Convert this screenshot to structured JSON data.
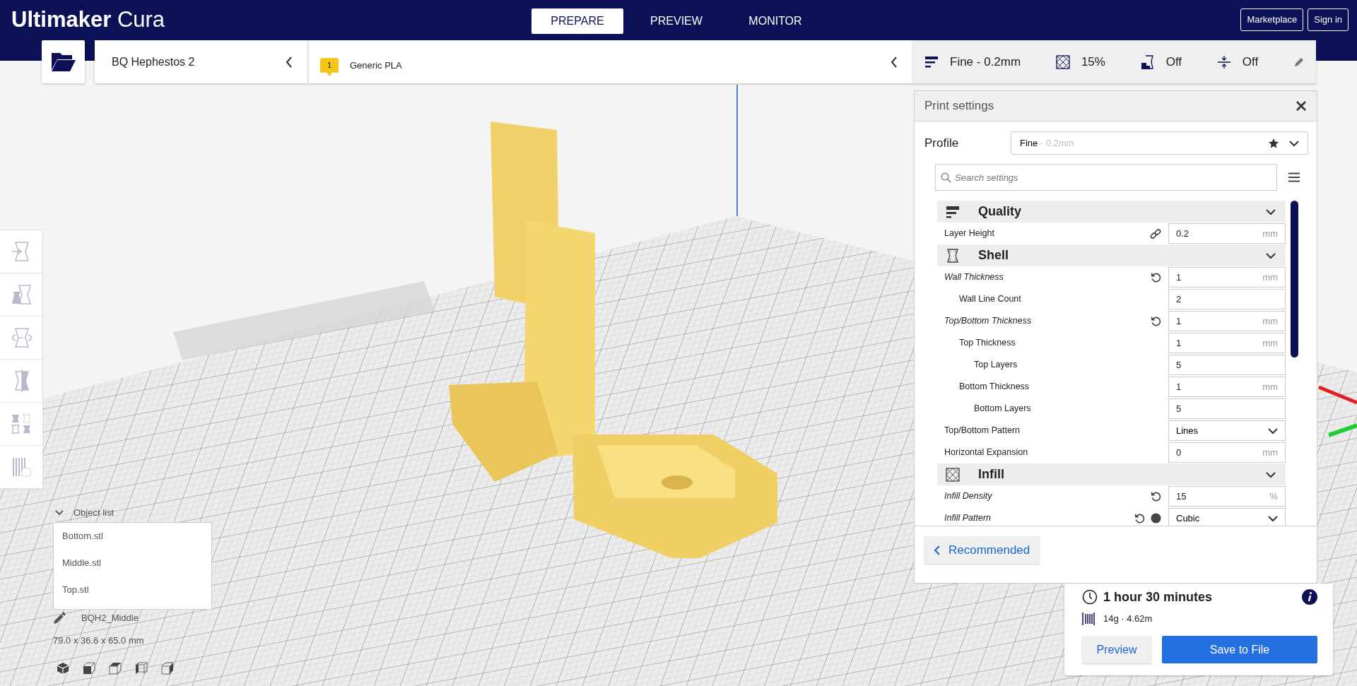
{
  "app": {
    "logo_bold": "Ultimaker",
    "logo_light": "Cura"
  },
  "stage_tabs": [
    {
      "label": "PREPARE",
      "selected": true
    },
    {
      "label": "PREVIEW",
      "selected": false
    },
    {
      "label": "MONITOR",
      "selected": false
    }
  ],
  "header_buttons": [
    "Marketplace",
    "Sign in"
  ],
  "printer": {
    "name": "BQ Hephestos 2"
  },
  "material": {
    "badge": "1",
    "name": "Generic PLA"
  },
  "print_summary": {
    "profile": "Fine - 0.2mm",
    "infill": "15%",
    "support": "Off",
    "adhesion": "Off"
  },
  "print_settings": {
    "title": "Print settings",
    "profile_label": "Profile",
    "profile_name": "Fine",
    "profile_detail": "- 0.2mm",
    "search_placeholder": "Search settings",
    "rows": [
      {
        "kind": "category",
        "label": "Quality",
        "expanded": true
      },
      {
        "kind": "text",
        "label": "Layer Height",
        "value": "0.2",
        "unit": "mm",
        "modified": false,
        "linked": true
      },
      {
        "kind": "category",
        "label": "Shell",
        "expanded": true
      },
      {
        "kind": "text",
        "label": "Wall Thickness",
        "value": "1",
        "unit": "mm",
        "modified": true,
        "children": [
          {
            "kind": "text",
            "label": "Wall Line Count",
            "value": "2",
            "modified": false
          }
        ]
      },
      {
        "kind": "text",
        "label": "Top/Bottom Thickness",
        "value": "1",
        "unit": "mm",
        "modified": true,
        "children": [
          {
            "kind": "text",
            "label": "Top Thickness",
            "value": "1",
            "unit": "mm",
            "modified": false,
            "children": [
              {
                "kind": "text",
                "label": "Top Layers",
                "value": "5",
                "modified": false
              }
            ]
          },
          {
            "kind": "text",
            "label": "Bottom Thickness",
            "value": "1",
            "unit": "mm",
            "modified": false,
            "children": [
              {
                "kind": "text",
                "label": "Bottom Layers",
                "value": "5",
                "modified": false
              }
            ]
          }
        ]
      },
      {
        "kind": "dropdown",
        "label": "Top/Bottom Pattern",
        "value": "Lines",
        "modified": false
      },
      {
        "kind": "text",
        "label": "Horizontal Expansion",
        "value": "0",
        "unit": "mm",
        "modified": false
      },
      {
        "kind": "category",
        "label": "Infill",
        "expanded": true
      },
      {
        "kind": "text",
        "label": "Infill Density",
        "value": "15",
        "unit": "%",
        "modified": true
      },
      {
        "kind": "dropdown",
        "label": "Infill Pattern",
        "value": "Cubic",
        "modified": true,
        "info": true
      }
    ],
    "mode_button": "Recommended"
  },
  "object_list": {
    "title": "Object list",
    "expanded": true,
    "items": [
      "Bottom.stl",
      "Middle.stl",
      "Top.stl"
    ],
    "selected_name": "BQH2_Middle",
    "dimensions": "79.0 x 36.6 x 65.0 mm"
  },
  "estimate": {
    "time": "1 hour 30 minutes",
    "material": "14g · 4.62m",
    "buttons": [
      "Preview",
      "Save to File"
    ]
  }
}
